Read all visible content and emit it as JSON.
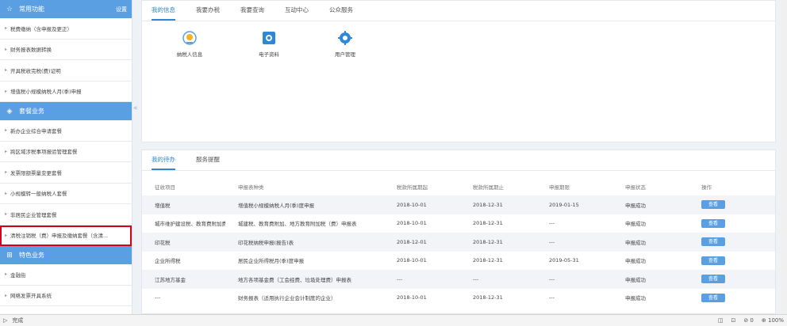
{
  "sidebar": {
    "common": {
      "title": "常用功能",
      "settings": "设置"
    },
    "common_items": [
      "税费缴纳（含申报及更正）",
      "财务报表数据转换",
      "开具税收完税(费)证明",
      "增值税小规模纳税人月(季)申报"
    ],
    "my_business": {
      "title": "套餐业务"
    },
    "business_items": [
      "新办企业综合申请套餐",
      "跨区域涉税事项报验管理套餐",
      "发票限额票量变更套餐",
      "小规模转一般纳税人套餐",
      "非居民企业管理套餐",
      "清税注销税（费）申报及缴纳套餐（含清..."
    ],
    "special": {
      "title": "特色业务"
    },
    "special_items": [
      "金融街",
      "网络发票开具系统"
    ]
  },
  "top_tabs": [
    "我的信息",
    "我要办税",
    "我要查询",
    "互动中心",
    "公众服务"
  ],
  "apps": [
    {
      "label": "纳税人信息",
      "icon": "taxpayer-info-icon"
    },
    {
      "label": "电子资料",
      "icon": "e-document-icon"
    },
    {
      "label": "用户管理",
      "icon": "user-settings-icon"
    }
  ],
  "todo_tabs": [
    "我的待办",
    "服务提醒"
  ],
  "table": {
    "headers": [
      "征收项目",
      "申报表种类",
      "税款所属期起",
      "税款所属期止",
      "申报期限",
      "申报状态",
      "操作"
    ],
    "rows": [
      [
        "增值税",
        "增值税小规模纳税人月(季)度申报",
        "2018-10-01",
        "2018-12-31",
        "2019-01-15",
        "申报成功",
        "查看"
      ],
      [
        "城市维护建设税、教育费附加费...",
        "城建税、教育费附加、地方教育附加税（费）申报表",
        "2018-10-01",
        "2018-12-31",
        "---",
        "申报成功",
        "查看"
      ],
      [
        "印花税",
        "印花税纳税申报(报告)表",
        "2018-12-01",
        "2018-12-31",
        "---",
        "申报成功",
        "查看"
      ],
      [
        "企业所得税",
        "居民企业所得税月(季)度申报",
        "2018-10-01",
        "2018-12-31",
        "2019-05-31",
        "申报成功",
        "查看"
      ],
      [
        "江苏地方基金",
        "地方各项基金费（工会经费、垃圾处理费）申报表",
        "---",
        "---",
        "---",
        "申报成功",
        "查看"
      ],
      [
        "---",
        "财务报表（适用执行企业会计制度的企业）",
        "2018-10-01",
        "2018-12-31",
        "---",
        "申报成功",
        "查看"
      ]
    ]
  },
  "statusbar": {
    "left": "完成",
    "zoom": "100%",
    "count": "0"
  },
  "colors": {
    "accent": "#5b9fe3",
    "highlight": "#d0021b"
  }
}
